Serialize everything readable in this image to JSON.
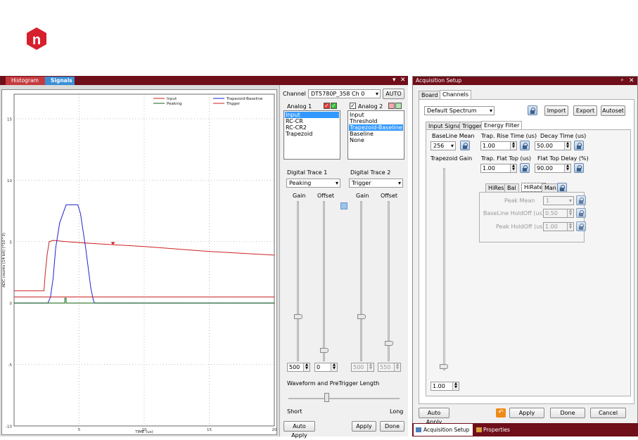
{
  "logo": {
    "letter": "n",
    "color": "#d7202e"
  },
  "signals_window": {
    "tabs": [
      "Histogram",
      "Signals"
    ],
    "active_tab": "Signals",
    "controls": {
      "pin": "▾",
      "close": "✕"
    }
  },
  "chart_data": {
    "type": "line",
    "xlabel": "TIME (us)",
    "ylabel": "ADC counts (14 bit) (*10^3)",
    "xlim": [
      0,
      20
    ],
    "ylim": [
      -10,
      17
    ],
    "xticks": [
      "5",
      "10",
      "15",
      "20"
    ],
    "yticks": [
      "15",
      "10",
      "5",
      "0",
      "-5",
      "-10"
    ],
    "legend": [
      "Input",
      "Trapezoid-Baseline",
      "Peaking",
      "Trigger"
    ],
    "legend_position": "top-right",
    "series": [
      {
        "name": "Input",
        "color": "#cc2222",
        "x": [
          0,
          2.3,
          2.4,
          2.55,
          2.7,
          3,
          4,
          6,
          10,
          15,
          20
        ],
        "y": [
          1,
          1,
          2.5,
          4,
          5,
          5.1,
          5.0,
          4.85,
          4.6,
          4.2,
          3.9
        ]
      },
      {
        "name": "Trapezoid-Baseline",
        "color": "#2222cc",
        "x": [
          0,
          2.6,
          2.8,
          3.0,
          3.2,
          3.5,
          3.9,
          4.0,
          4.9,
          5.1,
          5.5,
          5.9,
          6.1,
          6.2,
          20
        ],
        "y": [
          0,
          0,
          0.5,
          2,
          4.5,
          6.5,
          7.7,
          8.0,
          8.0,
          7.3,
          4.5,
          1.2,
          0.2,
          0,
          0
        ]
      },
      {
        "name": "Peaking",
        "color": "#116611",
        "x": [
          0,
          3.9,
          3.9,
          4.0,
          4.0,
          20
        ],
        "y": [
          0,
          0,
          0.4,
          0.4,
          0,
          0
        ]
      },
      {
        "name": "Trigger",
        "color": "#cc2222",
        "x": [
          0,
          20
        ],
        "y": [
          0.5,
          0.5
        ]
      }
    ],
    "marker": {
      "x": 7.6,
      "y": 4.85
    }
  },
  "side": {
    "channel_label": "Channel",
    "channel_value": "DT5780P_358 Ch 0",
    "auto_button": "AUTO",
    "analog1": {
      "label": "Analog 1",
      "options": [
        "Input",
        "RC-CR",
        "RC-CR2",
        "Trapezoid"
      ],
      "selected": "Input"
    },
    "analog2": {
      "label": "Analog 2",
      "options": [
        "Input",
        "Threshold",
        "Trapezoid-Baseline",
        "Baseline",
        "None"
      ],
      "selected": "Trapezoid-Baseline"
    },
    "digital1": {
      "label": "Digital Trace 1",
      "value": "Peaking"
    },
    "digital2": {
      "label": "Digital Trace 2",
      "value": "Trigger"
    },
    "gain_label": "Gain",
    "offset_label": "Offset",
    "gain1": "500",
    "offset1": "0",
    "gain2": "500",
    "offset2": "550",
    "waveform_label": "Waveform and PreTrigger Length",
    "short_label": "Short",
    "long_label": "Long",
    "auto_apply": "Auto Apply",
    "apply": "Apply",
    "done": "Done"
  },
  "acq": {
    "title": "Acquisition Setup",
    "tabs": [
      "Board",
      "Channels"
    ],
    "active": "Channels",
    "preset": "Default Spectrum",
    "import": "Import",
    "export": "Export",
    "autoset": "Autoset",
    "subtabs": [
      "Input Signal",
      "Trigger",
      "Energy Filter"
    ],
    "active_subtab": "Energy Filter",
    "baseline_mean_label": "BaseLine Mean",
    "baseline_mean": "256",
    "trap_gain_label": "Trapezoid Gain",
    "trap_gain": "1.00",
    "rise_label": "Trap. Rise Time (us)",
    "rise": "1.00",
    "decay_label": "Decay Time (us)",
    "decay": "50.00",
    "flat_label": "Trap. Flat Top (us)",
    "flat": "1.00",
    "delay_label": "Flat Top Delay (%)",
    "delay": "90.00",
    "rate_tabs": [
      "HiRes",
      "Bal",
      "HiRate",
      "Man"
    ],
    "active_rate": "HiRate",
    "peak_mean_label": "Peak Mean",
    "peak_mean": "1",
    "bl_holdoff_label": "BaseLine HoldOff (us)",
    "bl_holdoff": "0.50",
    "pk_holdoff_label": "Peak HoldOff (us)",
    "pk_holdoff": "1.00",
    "auto_apply": "Auto Apply",
    "apply": "Apply",
    "done": "Done",
    "cancel": "Cancel",
    "bottom_tabs": [
      "Acquisition Setup",
      "Properties"
    ]
  }
}
